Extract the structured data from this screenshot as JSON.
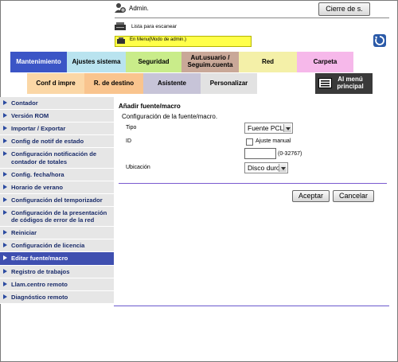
{
  "header": {
    "user_label": "Admin.",
    "logout_label": "Cierre de s.",
    "scan_status": "Lista para escanear",
    "mode_text": "En Menu(Modo de admin.)"
  },
  "tabs_row1": [
    {
      "label": "Mantenimiento",
      "color": "#3b55c6",
      "text_color": "#ffffff",
      "active": true
    },
    {
      "label": "Ajustes sistema",
      "color": "#b9e3ef"
    },
    {
      "label": "Seguridad",
      "color": "#c9ec8a"
    },
    {
      "label": "Aut.usuario / Seguim.cuenta",
      "color": "#c9a898"
    },
    {
      "label": "Red",
      "color": "#f4f0a8"
    },
    {
      "label": "Carpeta",
      "color": "#f6b8ea"
    }
  ],
  "tabs_row2": [
    {
      "label": "Conf d impre",
      "color": "#fbd7a6"
    },
    {
      "label": "R. de destino",
      "color": "#f9c48e"
    },
    {
      "label": "Asistente",
      "color": "#c7c4d8"
    },
    {
      "label": "Personalizar",
      "color": "#e2e2e2"
    },
    {
      "label": "Al menú principal",
      "color": "#3a3a3a",
      "text_color": "#ffffff"
    }
  ],
  "sidebar": {
    "items": [
      {
        "label": "Contador"
      },
      {
        "label": "Versión ROM"
      },
      {
        "label": "Importar / Exportar"
      },
      {
        "label": "Config de notif de estado"
      },
      {
        "label": "Configuración notificación de contador de totales"
      },
      {
        "label": "Config. fecha/hora"
      },
      {
        "label": "Horario de verano"
      },
      {
        "label": "Configuración del temporizador"
      },
      {
        "label": "Configuración de la presentación de códigos de error de la red"
      },
      {
        "label": "Reiniciar"
      },
      {
        "label": "Configuración de licencia"
      },
      {
        "label": "Editar fuente/macro",
        "active": true
      },
      {
        "label": "Registro de trabajos"
      },
      {
        "label": "Llam.centro remoto"
      },
      {
        "label": "Diagnóstico remoto"
      }
    ]
  },
  "main": {
    "title": "Añadir fuente/macro",
    "subtitle": "Configuración de la fuente/macro.",
    "type_label": "Tipo",
    "type_value": "Fuente PCL",
    "id_label": "ID",
    "manual_label": "Ajuste manual",
    "manual_checked": false,
    "id_value": "",
    "id_range": "(0-32767)",
    "location_label": "Ubicación",
    "location_value": "Disco duro",
    "ok_label": "Aceptar",
    "cancel_label": "Cancelar"
  }
}
